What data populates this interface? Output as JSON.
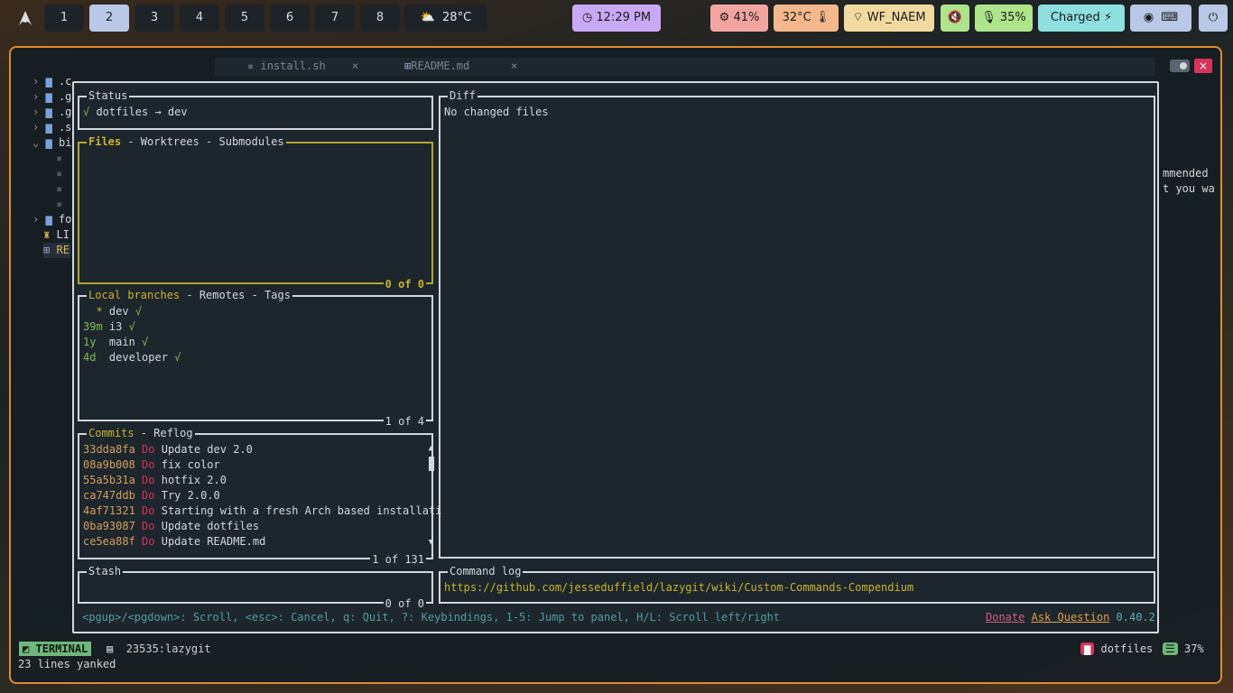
{
  "topbar": {
    "launcher_icon": "arch-logo",
    "workspaces": [
      "1",
      "2",
      "3",
      "4",
      "5",
      "6",
      "7",
      "8"
    ],
    "active_workspace": "2",
    "weather": {
      "icon": "partly-cloudy",
      "temp": "28°C"
    },
    "clock": "12:29 PM",
    "cpu": "41%",
    "temp": "32°C",
    "wifi": "WF_NAEM",
    "volume_muted": "muted",
    "mic": "35%",
    "battery": "Charged",
    "colors": {
      "clock": "#c9a8f5",
      "cpu": "#f2a5a0",
      "temp": "#f5b88c",
      "wifi": "#f1d9a0",
      "vol": "#aee48a",
      "mic": "#aee48a",
      "battery": "#8fe0e0",
      "tray": "#b8c8e6",
      "power": "#b8c8e6"
    }
  },
  "tree": [
    {
      "label": ".c",
      "indent": 0,
      "type": "folder"
    },
    {
      "label": ".g",
      "indent": 0,
      "type": "folder"
    },
    {
      "label": ".g",
      "indent": 0,
      "type": "folder"
    },
    {
      "label": ".s",
      "indent": 0,
      "type": "folder"
    },
    {
      "label": "bi",
      "indent": 0,
      "type": "folder-open"
    },
    {
      "label": "fo",
      "indent": 0,
      "type": "folder"
    },
    {
      "label": "LI",
      "indent": 0,
      "type": "license"
    },
    {
      "label": "RE",
      "indent": 0,
      "type": "markdown"
    }
  ],
  "tabs": [
    {
      "label": "install.sh",
      "close": "×"
    },
    {
      "label": "README.md",
      "close": "×"
    }
  ],
  "side_text": [
    "mmended",
    "t you wa"
  ],
  "lazygit": {
    "status": {
      "title": "Status",
      "line": "√ dotfiles → dev"
    },
    "files": {
      "title_active": "Files",
      "title_rest": " - Worktrees - Submodules",
      "footer": "0 of 0"
    },
    "branches": {
      "title_active": "Local branches",
      "title_rest": " - Remotes - Tags",
      "footer": "1 of 4",
      "rows": [
        {
          "age": "",
          "prefix": "  * ",
          "name": "dev",
          "check": " √"
        },
        {
          "age": "39m",
          "prefix": " ",
          "name": "i3",
          "check": " √"
        },
        {
          "age": "1y",
          "prefix": "  ",
          "name": "main",
          "check": " √"
        },
        {
          "age": "4d",
          "prefix": "  ",
          "name": "developer",
          "check": " √"
        }
      ]
    },
    "commits": {
      "title_active": "Commits",
      "title_rest": " - Reflog",
      "footer": "1 of 131",
      "rows": [
        {
          "hash": "33dda8fa",
          "author": "Do",
          "msg": "Update dev 2.0"
        },
        {
          "hash": "08a9b008",
          "author": "Do",
          "msg": "fix color"
        },
        {
          "hash": "55a5b31a",
          "author": "Do",
          "msg": "hotfix 2.0"
        },
        {
          "hash": "ca747ddb",
          "author": "Do",
          "msg": "Try 2.0.0"
        },
        {
          "hash": "4af71321",
          "author": "Do",
          "msg": "Starting with a fresh Arch based installati"
        },
        {
          "hash": "0ba93087",
          "author": "Do",
          "msg": "Update dotfiles"
        },
        {
          "hash": "ce5ea88f",
          "author": "Do",
          "msg": "Update README.md"
        }
      ]
    },
    "stash": {
      "title": "Stash",
      "footer": "0 of 0"
    },
    "diff": {
      "title": "Diff",
      "line": "No changed files"
    },
    "cmdlog": {
      "title": "Command log",
      "line": "https://github.com/jesseduffield/lazygit/wiki/Custom-Commands-Compendium"
    },
    "help": "<pgup>/<pgdown>: Scroll, <esc>: Cancel, q: Quit, ?: Keybindings, 1-5: Jump to panel, H/L: Scroll left/right",
    "donate": "Donate",
    "ask": "Ask Question",
    "version": "0.40.2"
  },
  "statusline": {
    "mode": "TERMINAL",
    "proc": "23535:lazygit",
    "repo": "dotfiles",
    "percent": "37%"
  },
  "message": "23 lines yanked"
}
